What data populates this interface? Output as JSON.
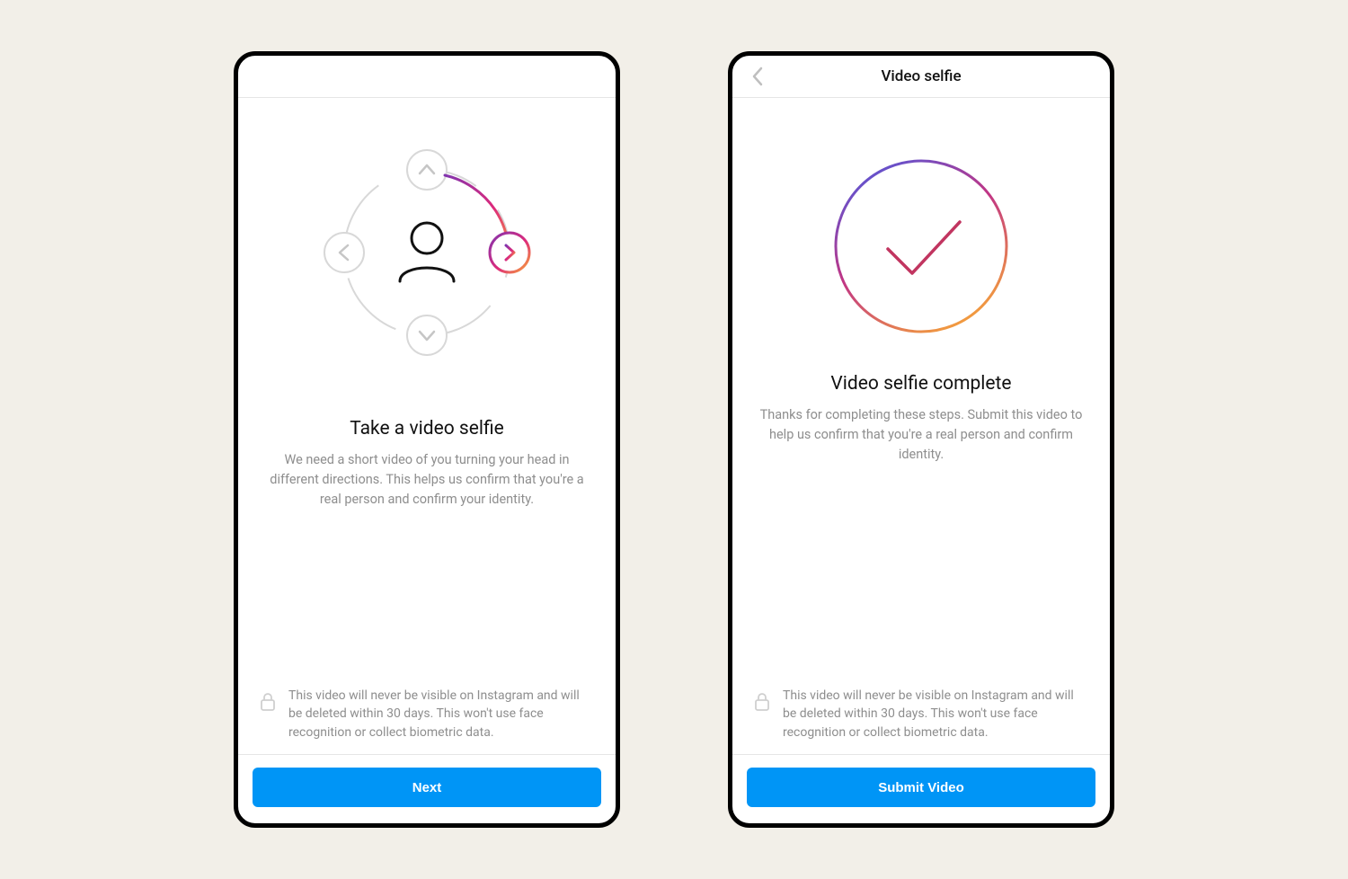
{
  "colors": {
    "accent": "#0095f6",
    "gradient_purple": "#8134af",
    "gradient_pink": "#dd2a7b",
    "gradient_orange": "#f8a836"
  },
  "privacy_notice": "This video will never be visible on Instagram and will be deleted within 30 days. This won't use face recognition or collect biometric data.",
  "screens": {
    "intro": {
      "heading": "Take a video selfie",
      "body": "We need a short video of you turning your head in different directions. This helps us confirm that you're a real person and confirm your identity.",
      "cta": "Next"
    },
    "complete": {
      "header_title": "Video selfie",
      "heading": "Video selfie complete",
      "body": "Thanks for completing these steps. Submit this video to help us confirm that you're a real person and confirm identity.",
      "cta": "Submit Video"
    }
  }
}
